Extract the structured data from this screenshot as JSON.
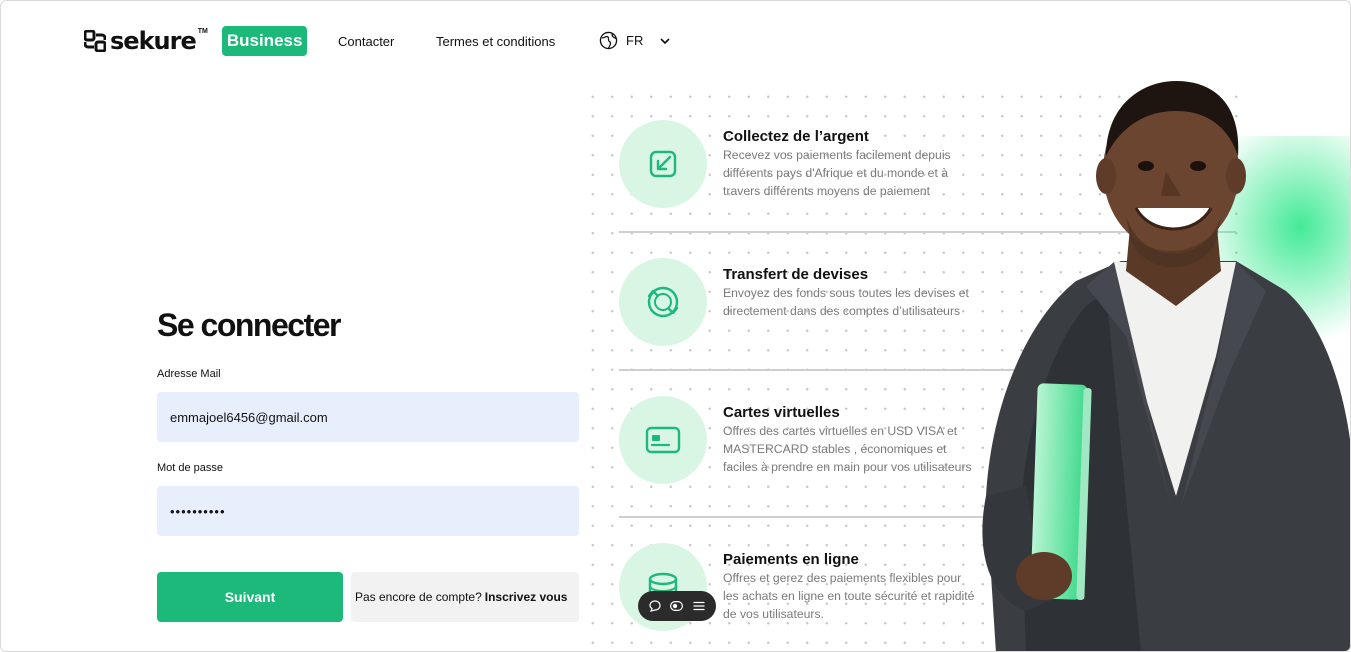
{
  "header": {
    "logo_text": "sekure",
    "logo_tm": "TM",
    "logo_badge": "Business",
    "nav": [
      "Contacter",
      "Termes et conditions"
    ],
    "lang_label": "FR"
  },
  "login": {
    "title": "Se connecter",
    "email_label": "Adresse Mail",
    "email_value": "emmajoel6456@gmail.com",
    "password_label": "Mot de passe",
    "password_value": "••••••••••",
    "submit_label": "Suivant",
    "signup_prompt": "Pas encore de compte?",
    "signup_link": "Inscrivez vous"
  },
  "features": [
    {
      "title": "Collectez de l’argent",
      "desc": "Recevez vos paiements facilement depuis différents pays d'Afrique et du monde et à travers différents moyens de paiement",
      "icon": "arrow-in-icon"
    },
    {
      "title": "Transfert de devises",
      "desc": "Envoyez des fonds sous toutes les devises et directement dans des comptes d’utilisateurs",
      "icon": "exchange-icon"
    },
    {
      "title": "Cartes virtuelles",
      "desc": "Offres des cartes virtuelles en USD VISA et MASTERCARD stables , économiques et faciles à prendre en main pour vos utilisateurs",
      "icon": "card-icon"
    },
    {
      "title": "Paiements en ligne",
      "desc": "Offres et gerez des paiements flexibles pour les achats en ligne en toute sécurité et rapidité de vos utilisateurs.",
      "icon": "coins-icon"
    }
  ],
  "colors": {
    "accent": "#1db97a",
    "icon_bg": "#d9f6e4",
    "input_bg": "#e8effc"
  }
}
